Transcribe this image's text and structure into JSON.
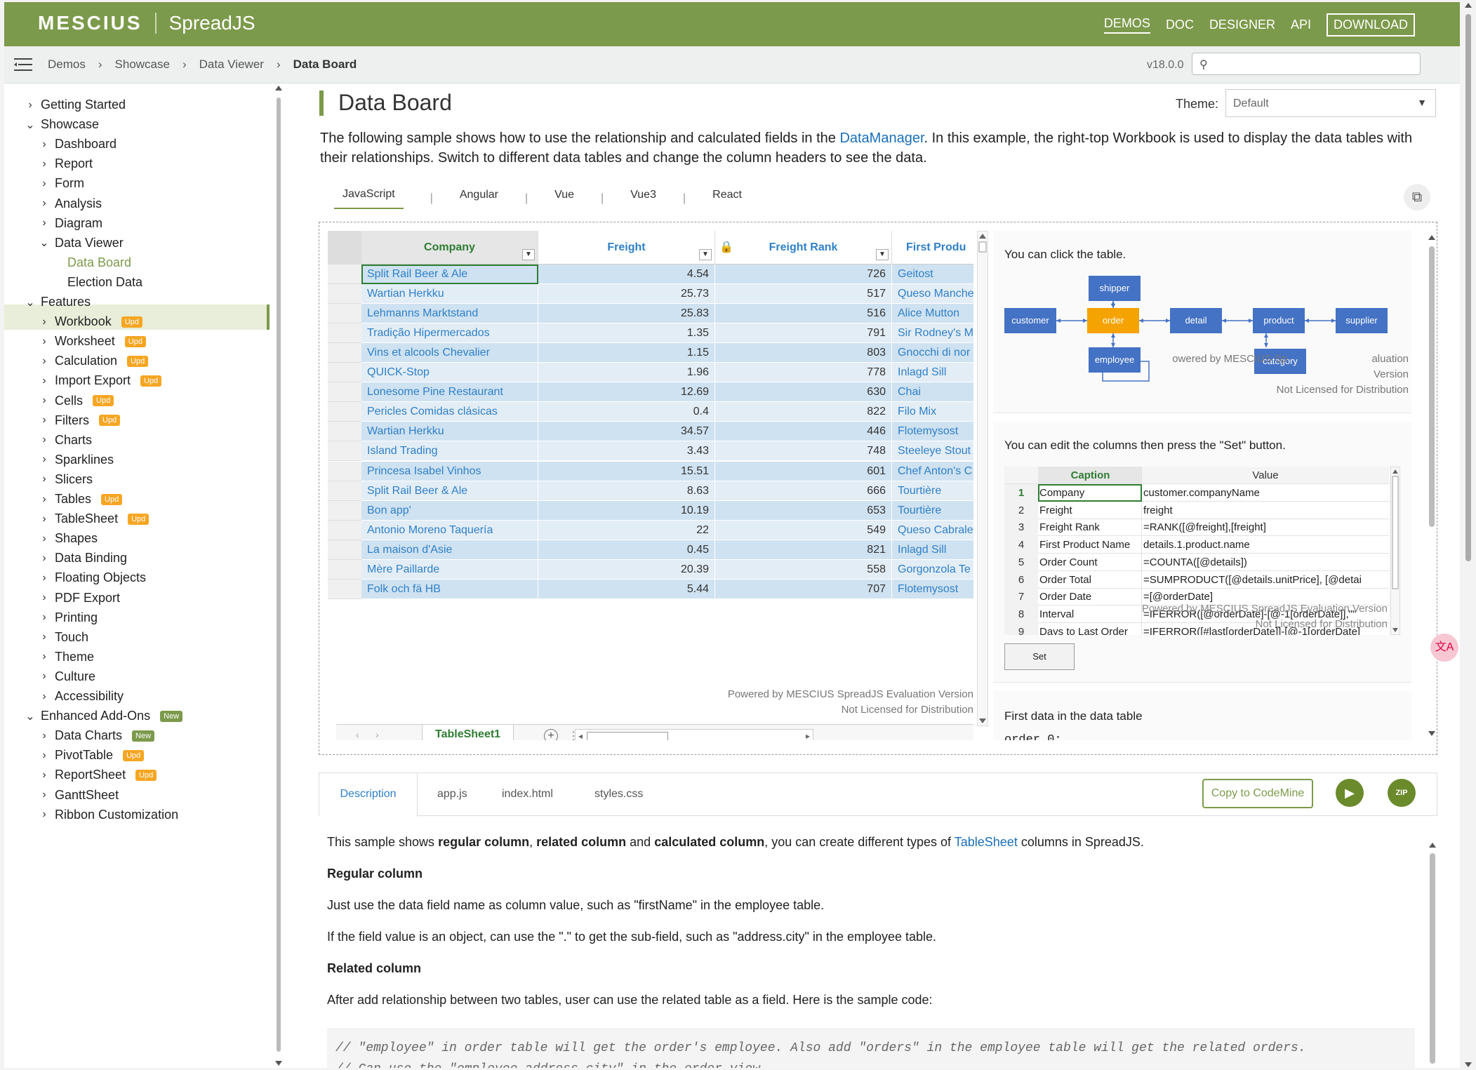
{
  "header": {
    "logo_text": "MESCIUS",
    "product": "SpreadJS",
    "nav": [
      "DEMOS",
      "DOC",
      "DESIGNER",
      "API",
      "DOWNLOAD"
    ]
  },
  "breadcrumb": {
    "items": [
      "Demos",
      "Showcase",
      "Data Viewer",
      "Data Board"
    ],
    "version": "v18.0.0",
    "search_placeholder": ""
  },
  "sidebar": {
    "items": [
      {
        "label": "Getting Started",
        "level": 0,
        "expanded": false
      },
      {
        "label": "Showcase",
        "level": 0,
        "expanded": true
      },
      {
        "label": "Dashboard",
        "level": 1
      },
      {
        "label": "Report",
        "level": 1
      },
      {
        "label": "Form",
        "level": 1
      },
      {
        "label": "Analysis",
        "level": 1
      },
      {
        "label": "Diagram",
        "level": 1
      },
      {
        "label": "Data Viewer",
        "level": 1,
        "expanded": true
      },
      {
        "label": "Data Board",
        "level": 2,
        "active": true
      },
      {
        "label": "Election Data",
        "level": 2
      },
      {
        "label": "Features",
        "level": 0,
        "expanded": true
      },
      {
        "label": "Workbook",
        "level": 1,
        "badge": "Upd"
      },
      {
        "label": "Worksheet",
        "level": 1,
        "badge": "Upd"
      },
      {
        "label": "Calculation",
        "level": 1,
        "badge": "Upd"
      },
      {
        "label": "Import Export",
        "level": 1,
        "badge": "Upd"
      },
      {
        "label": "Cells",
        "level": 1,
        "badge": "Upd"
      },
      {
        "label": "Filters",
        "level": 1,
        "badge": "Upd"
      },
      {
        "label": "Charts",
        "level": 1
      },
      {
        "label": "Sparklines",
        "level": 1
      },
      {
        "label": "Slicers",
        "level": 1
      },
      {
        "label": "Tables",
        "level": 1,
        "badge": "Upd"
      },
      {
        "label": "TableSheet",
        "level": 1,
        "badge": "Upd"
      },
      {
        "label": "Shapes",
        "level": 1
      },
      {
        "label": "Data Binding",
        "level": 1
      },
      {
        "label": "Floating Objects",
        "level": 1
      },
      {
        "label": "PDF Export",
        "level": 1
      },
      {
        "label": "Printing",
        "level": 1
      },
      {
        "label": "Touch",
        "level": 1
      },
      {
        "label": "Theme",
        "level": 1
      },
      {
        "label": "Culture",
        "level": 1
      },
      {
        "label": "Accessibility",
        "level": 1
      },
      {
        "label": "Enhanced Add-Ons",
        "level": 0,
        "expanded": true,
        "badge": "New"
      },
      {
        "label": "Data Charts",
        "level": 1,
        "badge": "New"
      },
      {
        "label": "PivotTable",
        "level": 1,
        "badge": "Upd"
      },
      {
        "label": "ReportSheet",
        "level": 1,
        "badge": "Upd"
      },
      {
        "label": "GanttSheet",
        "level": 1
      },
      {
        "label": "Ribbon Customization",
        "level": 1
      }
    ]
  },
  "main": {
    "title": "Data Board",
    "theme_label": "Theme:",
    "theme_value": "Default",
    "intro_before": "The following sample shows how to use the relationship and calculated fields in the ",
    "intro_link": "DataManager",
    "intro_after": ". In this example, the right-top Workbook is used to display the data tables with their relationships. Switch to different data tables and change the column headers to see the data.",
    "tabs": [
      "JavaScript",
      "Angular",
      "Vue",
      "Vue3",
      "React"
    ]
  },
  "grid": {
    "headers": [
      "Company",
      "Freight",
      "Freight Rank",
      "First Produ"
    ],
    "rows": [
      [
        "Split Rail Beer & Ale",
        "4.54",
        "726",
        "Geitost"
      ],
      [
        "Wartian Herkku",
        "25.73",
        "517",
        "Queso Manche"
      ],
      [
        "Lehmanns Marktstand",
        "25.83",
        "516",
        "Alice Mutton"
      ],
      [
        "Tradição Hipermercados",
        "1.35",
        "791",
        "Sir Rodney's M"
      ],
      [
        "Vins et alcools Chevalier",
        "1.15",
        "803",
        "Gnocchi di nor"
      ],
      [
        "QUICK-Stop",
        "1.96",
        "778",
        "Inlagd Sill"
      ],
      [
        "Lonesome Pine Restaurant",
        "12.69",
        "630",
        "Chai"
      ],
      [
        "Pericles Comidas clásicas",
        "0.4",
        "822",
        "Filo Mix"
      ],
      [
        "Wartian Herkku",
        "34.57",
        "446",
        "Flotemysost"
      ],
      [
        "Island Trading",
        "3.43",
        "748",
        "Steeleye Stout"
      ],
      [
        "Princesa Isabel Vinhos",
        "15.51",
        "601",
        "Chef Anton's C"
      ],
      [
        "Split Rail Beer & Ale",
        "8.63",
        "666",
        "Tourtière"
      ],
      [
        "Bon app'",
        "10.19",
        "653",
        "Tourtière"
      ],
      [
        "Antonio Moreno Taquería",
        "22",
        "549",
        "Queso Cabrale"
      ],
      [
        "La maison d'Asie",
        "0.45",
        "821",
        "Inlagd Sill"
      ],
      [
        "Mère Paillarde",
        "20.39",
        "558",
        "Gorgonzola Te"
      ],
      [
        "Folk och fä HB",
        "5.44",
        "707",
        "Flotemysost"
      ]
    ],
    "sheet_tab": "TableSheet1",
    "watermark_1": "Powered by MESCIUS SpreadJS Evaluation Version",
    "watermark_2": "Not Licensed for Distribution"
  },
  "panel": {
    "diagram_hint": "You can click the table.",
    "nodes": [
      "shipper",
      "customer",
      "order",
      "detail",
      "product",
      "supplier",
      "employee",
      "category"
    ],
    "diagram_wm_1": "owered by MESCIUS Sp",
    "diagram_wm_2": "aluation Version",
    "diagram_wm_3": "Not Licensed for Distribution",
    "columns_hint": "You can edit the columns then press the \"Set\" button.",
    "col_headers": [
      "Caption",
      "Value"
    ],
    "columns": [
      [
        "1",
        "Company",
        "customer.companyName"
      ],
      [
        "2",
        "Freight",
        "freight"
      ],
      [
        "3",
        "Freight Rank",
        "=RANK([@freight],[freight]"
      ],
      [
        "4",
        "First Product Name",
        "details.1.product.name"
      ],
      [
        "5",
        "Order Count",
        "=COUNTA([@details])"
      ],
      [
        "6",
        "Order Total",
        "=SUMPRODUCT([@details.unitPrice], [@detai"
      ],
      [
        "7",
        "Order Date",
        "=[@orderDate]"
      ],
      [
        "8",
        "Interval",
        "=IFERROR([@orderDate]-[@-1[orderDate]],\"\""
      ],
      [
        "9",
        "Days to Last Order",
        "=IFERROR([#last[orderDate]]-[@-1[orderDate]"
      ]
    ],
    "set_label": "Set",
    "first_data_label": "First data in the data table",
    "first_data_cut": "order 0:"
  },
  "bottom": {
    "tabs": [
      "Description",
      "app.js",
      "index.html",
      "styles.css"
    ],
    "copy_label": "Copy to CodeMine",
    "zip_label": "ZIP",
    "desc_p1_a": "This sample shows ",
    "desc_p1_b": "regular column",
    "desc_p1_c": ", ",
    "desc_p1_d": "related column",
    "desc_p1_e": " and ",
    "desc_p1_f": "calculated column",
    "desc_p1_g": ", you can create different types of ",
    "desc_p1_link": "TableSheet",
    "desc_p1_h": " columns in SpreadJS.",
    "h_regular": "Regular column",
    "p_regular_1": "Just use the data field name as column value, such as \"firstName\" in the employee table.",
    "p_regular_2": "If the field value is an object, can use the \".\" to get the sub-field, such as \"address.city\" in the employee table.",
    "h_related": "Related column",
    "p_related": "After add relationship between two tables, user can use the related table as a field. Here is the sample code:",
    "code_1": "// \"employee\" in order table will get the order's employee. Also add \"orders\" in the employee table will get the related orders.",
    "code_2": "// Can use the \"employee.address.city\" in the order view."
  },
  "colors": {
    "brand": "#7c9a4b",
    "link": "#1a6fb8",
    "order_node": "#f5a300",
    "node": "#4472c4"
  }
}
